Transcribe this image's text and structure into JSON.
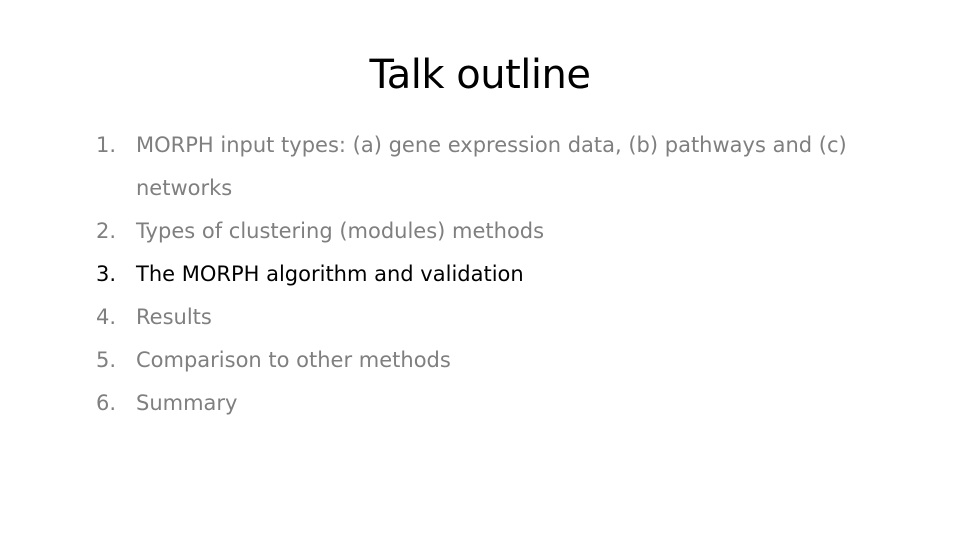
{
  "slide": {
    "title": "Talk outline",
    "active_color": "#000000",
    "inactive_color": "#7f7f7f",
    "items": [
      {
        "number": "1.",
        "text": "MORPH input types: (a) gene expression data, (b) pathways and (c) networks",
        "active": false
      },
      {
        "number": "2.",
        "text": "Types of clustering (modules) methods",
        "active": false
      },
      {
        "number": "3.",
        "text": "The MORPH algorithm and validation",
        "active": true
      },
      {
        "number": "4.",
        "text": "Results",
        "active": false
      },
      {
        "number": "5.",
        "text": "Comparison to other methods",
        "active": false
      },
      {
        "number": "6.",
        "text": "Summary",
        "active": false
      }
    ]
  }
}
